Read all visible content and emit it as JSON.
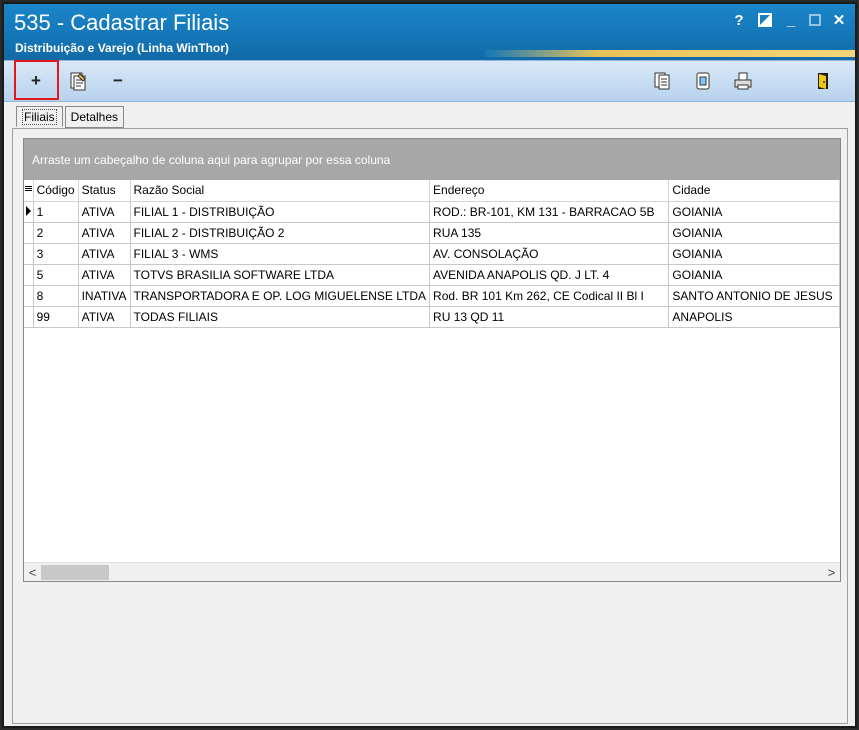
{
  "window": {
    "title": "535 - Cadastrar Filiais",
    "subtitle": "Distribuição e Varejo (Linha WinThor)",
    "help_label": "?",
    "minimize_label": "_",
    "close_label": "✕"
  },
  "toolbar": {
    "icons": [
      "add-icon",
      "edit-icon",
      "remove-icon",
      "copy-icon",
      "report-icon",
      "print-icon",
      "exit-icon"
    ],
    "add_label": "+",
    "remove_label": "−",
    "highlight_color": "#e0191e"
  },
  "tabs": [
    {
      "label": "Filiais",
      "active": true
    },
    {
      "label": "Detalhes",
      "active": false
    }
  ],
  "grid": {
    "group_hint": "Arraste um cabeçalho de coluna aqui para agrupar por essa coluna",
    "columns": [
      "Código",
      "Status",
      "Razão Social",
      "Endereço",
      "Cidade"
    ],
    "rows": [
      {
        "codigo": "1",
        "status": "ATIVA",
        "razao": "FILIAL 1 - DISTRIBUIÇÃO",
        "endereco": "ROD.: BR-101, KM 131 - BARRACAO 5B",
        "cidade": "GOIANIA"
      },
      {
        "codigo": "2",
        "status": "ATIVA",
        "razao": "FILIAL 2 - DISTRIBUIÇÃO 2",
        "endereco": "RUA 135",
        "cidade": "GOIANIA"
      },
      {
        "codigo": "3",
        "status": "ATIVA",
        "razao": "FILIAL 3 - WMS",
        "endereco": "AV. CONSOLAÇÃO",
        "cidade": "GOIANIA"
      },
      {
        "codigo": "5",
        "status": "ATIVA",
        "razao": "TOTVS BRASILIA SOFTWARE LTDA",
        "endereco": "AVENIDA  ANAPOLIS QD. J LT. 4",
        "cidade": "GOIANIA"
      },
      {
        "codigo": "8",
        "status": "INATIVA",
        "razao": "TRANSPORTADORA E OP. LOG MIGUELENSE LTDA",
        "endereco": "Rod. BR 101 Km 262, CE Codical II Bl I",
        "cidade": "SANTO ANTONIO DE JESUS"
      },
      {
        "codigo": "99",
        "status": "ATIVA",
        "razao": "TODAS FILIAIS",
        "endereco": "RU 13 QD 11",
        "cidade": "ANAPOLIS"
      }
    ]
  },
  "scrollbar": {
    "left_label": "<",
    "right_label": ">"
  }
}
